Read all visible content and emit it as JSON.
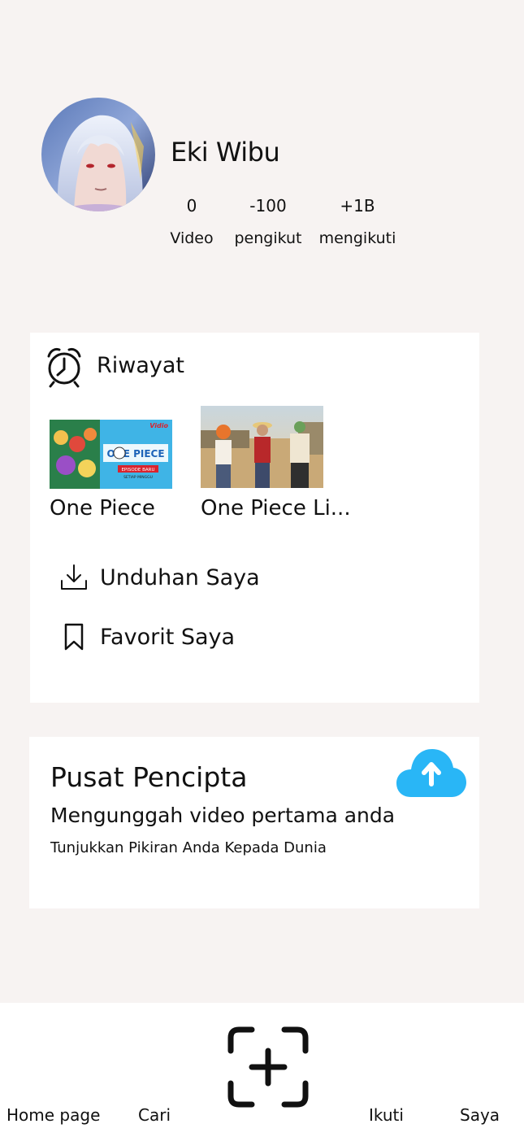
{
  "profile": {
    "name": "Eki Wibu",
    "stats": [
      {
        "value": "0",
        "label": "Video"
      },
      {
        "value": "-100",
        "label": "pengikut"
      },
      {
        "value": "+1B",
        "label": "mengikuti"
      }
    ]
  },
  "history": {
    "title": "Riwayat",
    "icon": "alarm-clock-icon",
    "videos": [
      {
        "title": "One Piece",
        "thumb_badge": "Vidio",
        "thumb_logo": "ONE PIECE",
        "thumb_caption": "EPISODE BARU",
        "thumb_subcaption": "SETIAP MINGGU"
      },
      {
        "title": "One Piece Li..."
      }
    ]
  },
  "menu": {
    "downloads": {
      "label": "Unduhan Saya",
      "icon": "download-icon"
    },
    "favorites": {
      "label": "Favorit Saya",
      "icon": "bookmark-icon"
    }
  },
  "creator": {
    "title": "Pusat Pencipta",
    "subtitle": "Mengunggah video pertama anda",
    "description": "Tunjukkan Pikiran Anda Kepada Dunia",
    "icon": "cloud-upload-icon",
    "accent_color": "#29b6f6"
  },
  "nav": {
    "home": "Home page",
    "search": "Cari",
    "create_icon": "scan-plus-icon",
    "follow": "Ikuti",
    "me": "Saya"
  }
}
